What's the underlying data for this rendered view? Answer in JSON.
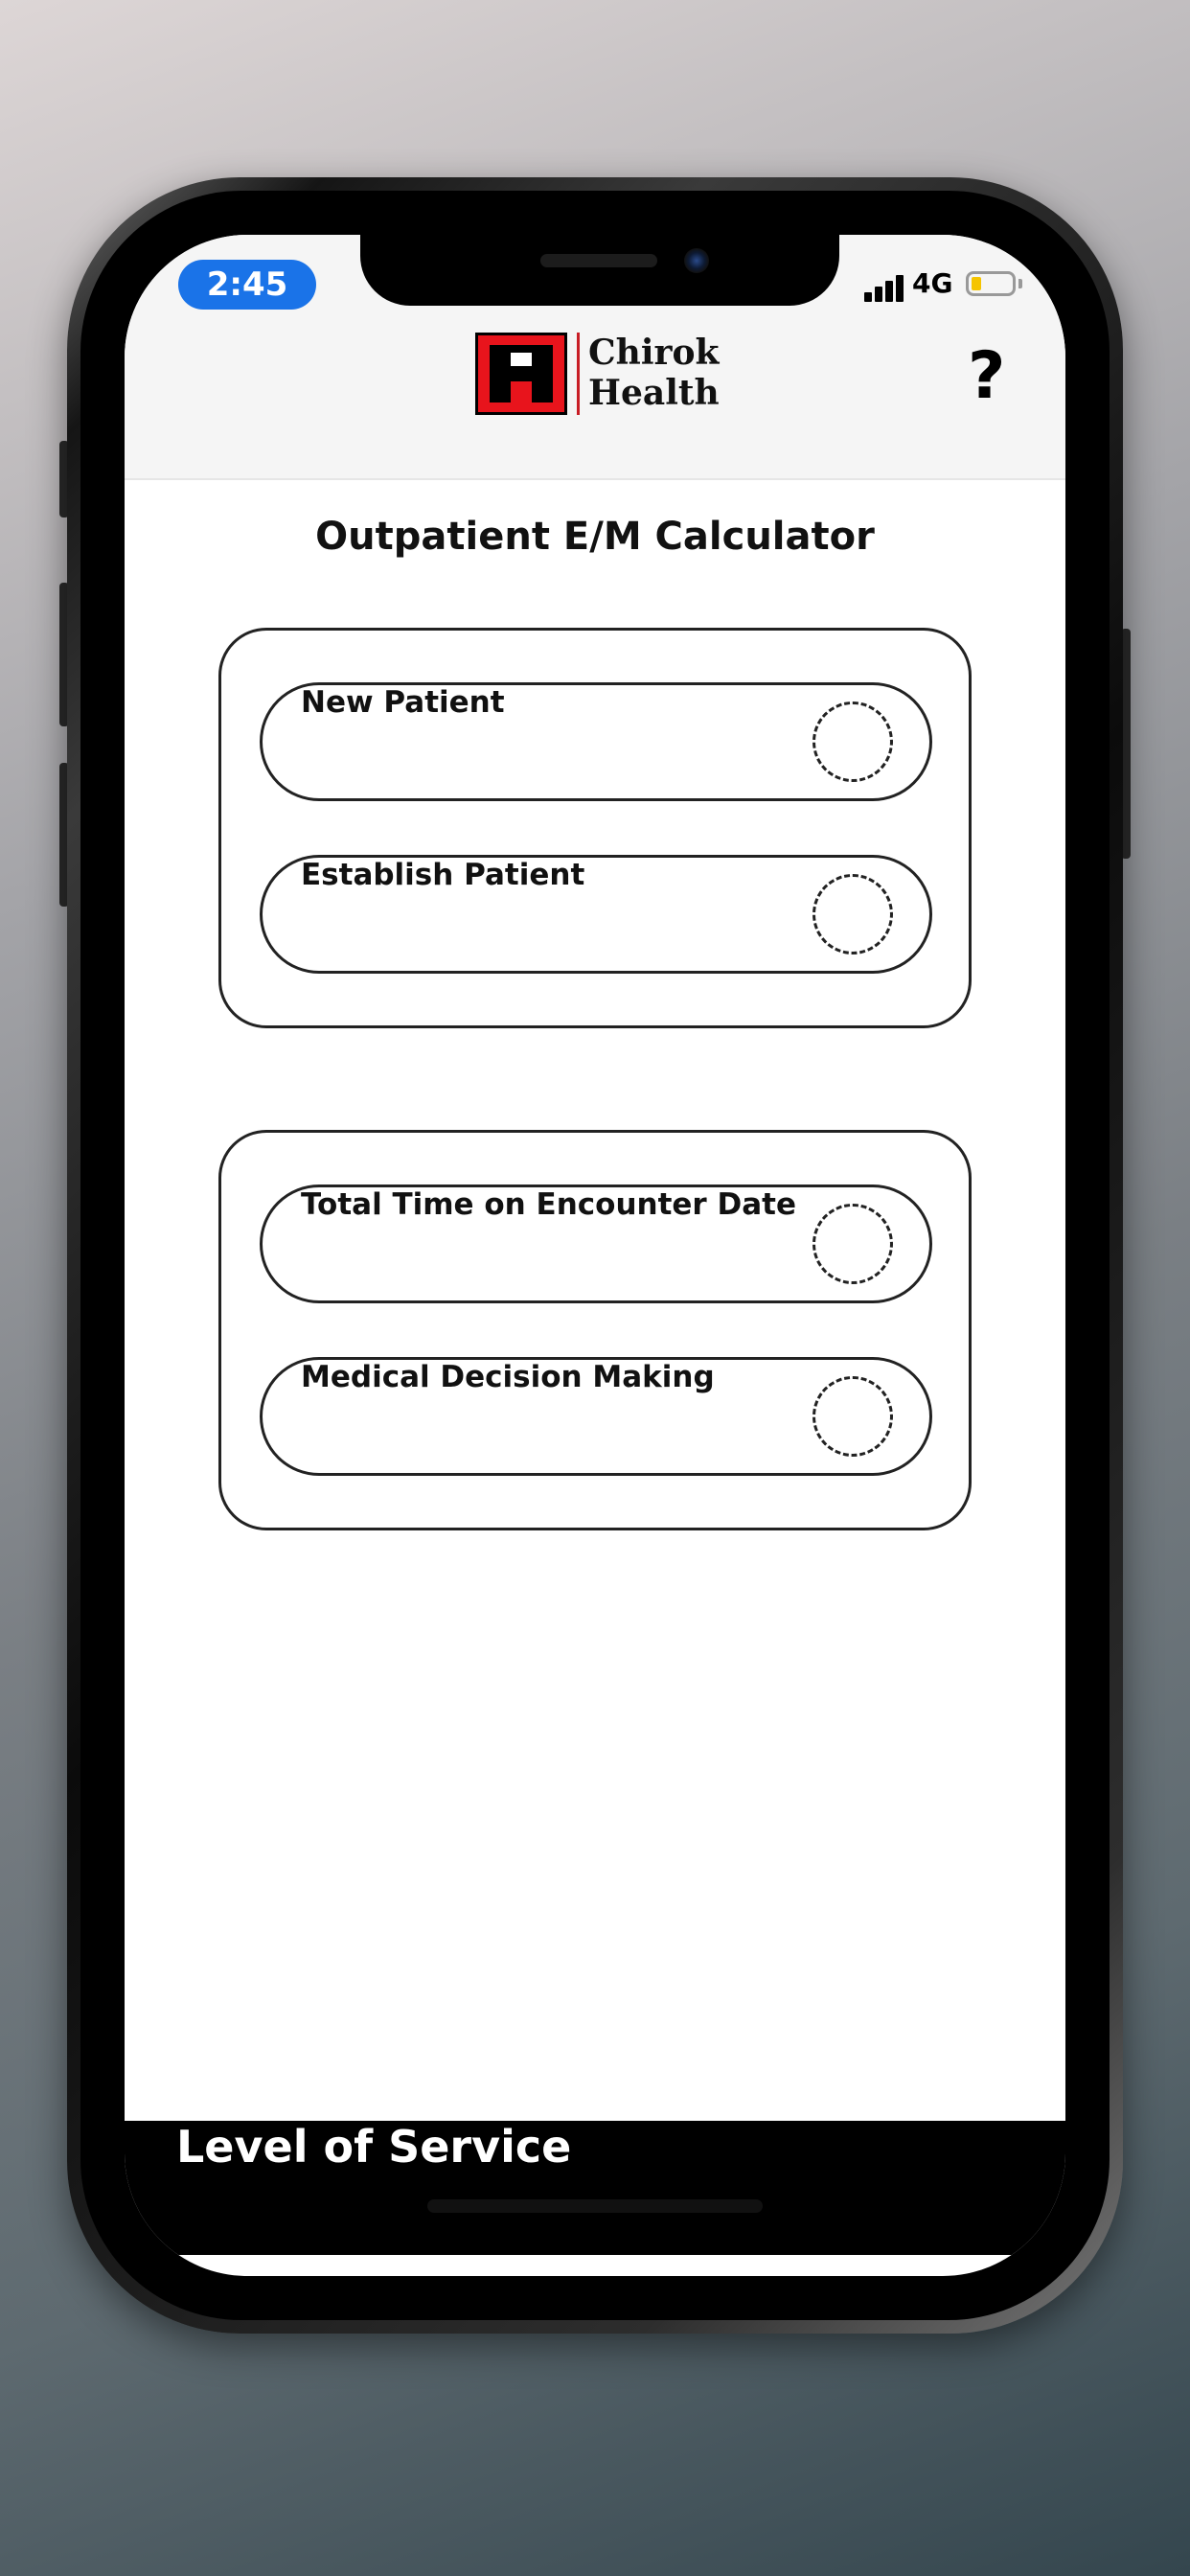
{
  "status_bar": {
    "time": "2:45",
    "network": "4G",
    "battery_level": 0.25,
    "time_pill_color": "#1a73e8",
    "battery_color": "#f5c400"
  },
  "header": {
    "logo_line1": "Chirok",
    "logo_line2": "Health",
    "logo_color": "#e8141c",
    "help_label": "?",
    "help_icon": "question-mark-icon"
  },
  "page": {
    "title": "Outpatient E/M Calculator"
  },
  "patient_type": {
    "options": [
      {
        "label": "New Patient",
        "selected": false
      },
      {
        "label": "Establish Patient",
        "selected": false
      }
    ]
  },
  "method": {
    "options": [
      {
        "label": "Total Time on Encounter Date",
        "selected": false
      },
      {
        "label": "Medical Decision Making",
        "selected": false
      }
    ]
  },
  "footer": {
    "label": "Level of Service"
  }
}
